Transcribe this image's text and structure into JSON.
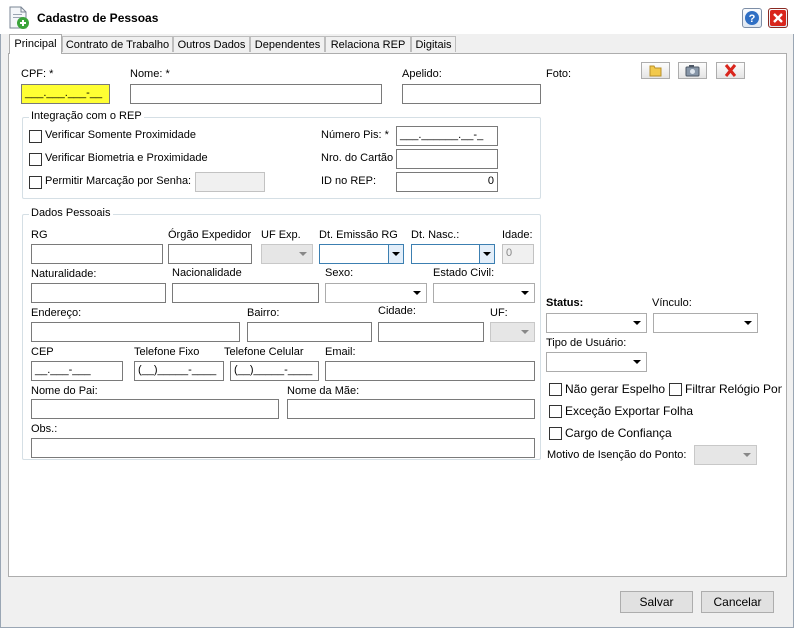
{
  "window": {
    "title": "Cadastro de Pessoas",
    "icon": "person-doc-icon"
  },
  "tabs": [
    {
      "label": "Principal",
      "active": true
    },
    {
      "label": "Contrato de Trabalho"
    },
    {
      "label": "Outros Dados"
    },
    {
      "label": "Dependentes"
    },
    {
      "label": "Relaciona REP"
    },
    {
      "label": "Digitais"
    }
  ],
  "form": {
    "cpf_label": "CPF: *",
    "cpf_value": "___.___.___-__",
    "nome_label": "Nome: *",
    "nome_value": "",
    "apelido_label": "Apelido:",
    "apelido_value": "",
    "foto_label": "Foto:"
  },
  "rep": {
    "title": "Integração com o REP",
    "check_proximidade": "Verificar Somente Proximidade",
    "check_biometria": "Verificar Biometria e Proximidade",
    "check_senha": "Permitir Marcação por Senha:",
    "pis_label": "Número Pis: *",
    "pis_value": "___.______.__-_",
    "cartao_label": "Nro. do Cartão",
    "cartao_value": "",
    "idrep_label": "ID no REP:",
    "idrep_value": "0"
  },
  "pessoais": {
    "title": "Dados Pessoais",
    "rg": "RG",
    "orgao": "Órgão Expedidor",
    "uf_exp": "UF Exp.",
    "dt_emissao": "Dt. Emissão RG",
    "dt_nasc": "Dt. Nasc.:",
    "idade": "Idade:",
    "idade_value": "0",
    "naturalidade": "Naturalidade:",
    "nacionalidade": "Nacionalidade",
    "sexo": "Sexo:",
    "estado_civil": "Estado Civil:",
    "endereco": "Endereço:",
    "bairro": "Bairro:",
    "cidade": "Cidade:",
    "uf": "UF:",
    "cep": "CEP",
    "cep_value": "__.___-___",
    "tel_fixo": "Telefone Fixo",
    "tel_fixo_value": "(__)_____-____",
    "tel_cel": "Telefone Celular",
    "tel_cel_value": "(__)_____-____",
    "email": "Email:",
    "pai": "Nome do Pai:",
    "mae": "Nome da Mãe:",
    "obs": "Obs.:"
  },
  "side": {
    "status": "Status:",
    "vinculo": "Vínculo:",
    "tipo_usuario": "Tipo de Usuário:",
    "nao_gerar_espelho": "Não gerar Espelho",
    "filtrar_relogio": "Filtrar Relógio Pont",
    "excecao_exportar": "Exceção Exportar Folha",
    "cargo_confianca": "Cargo de Confiança",
    "motivo_isencao": "Motivo de Isenção do Ponto:"
  },
  "buttons": {
    "save": "Salvar",
    "cancel": "Cancelar"
  },
  "colors": {
    "required_field": "#ffff33",
    "close_button": "#d9251c",
    "help_button": "#2f6fc4"
  }
}
